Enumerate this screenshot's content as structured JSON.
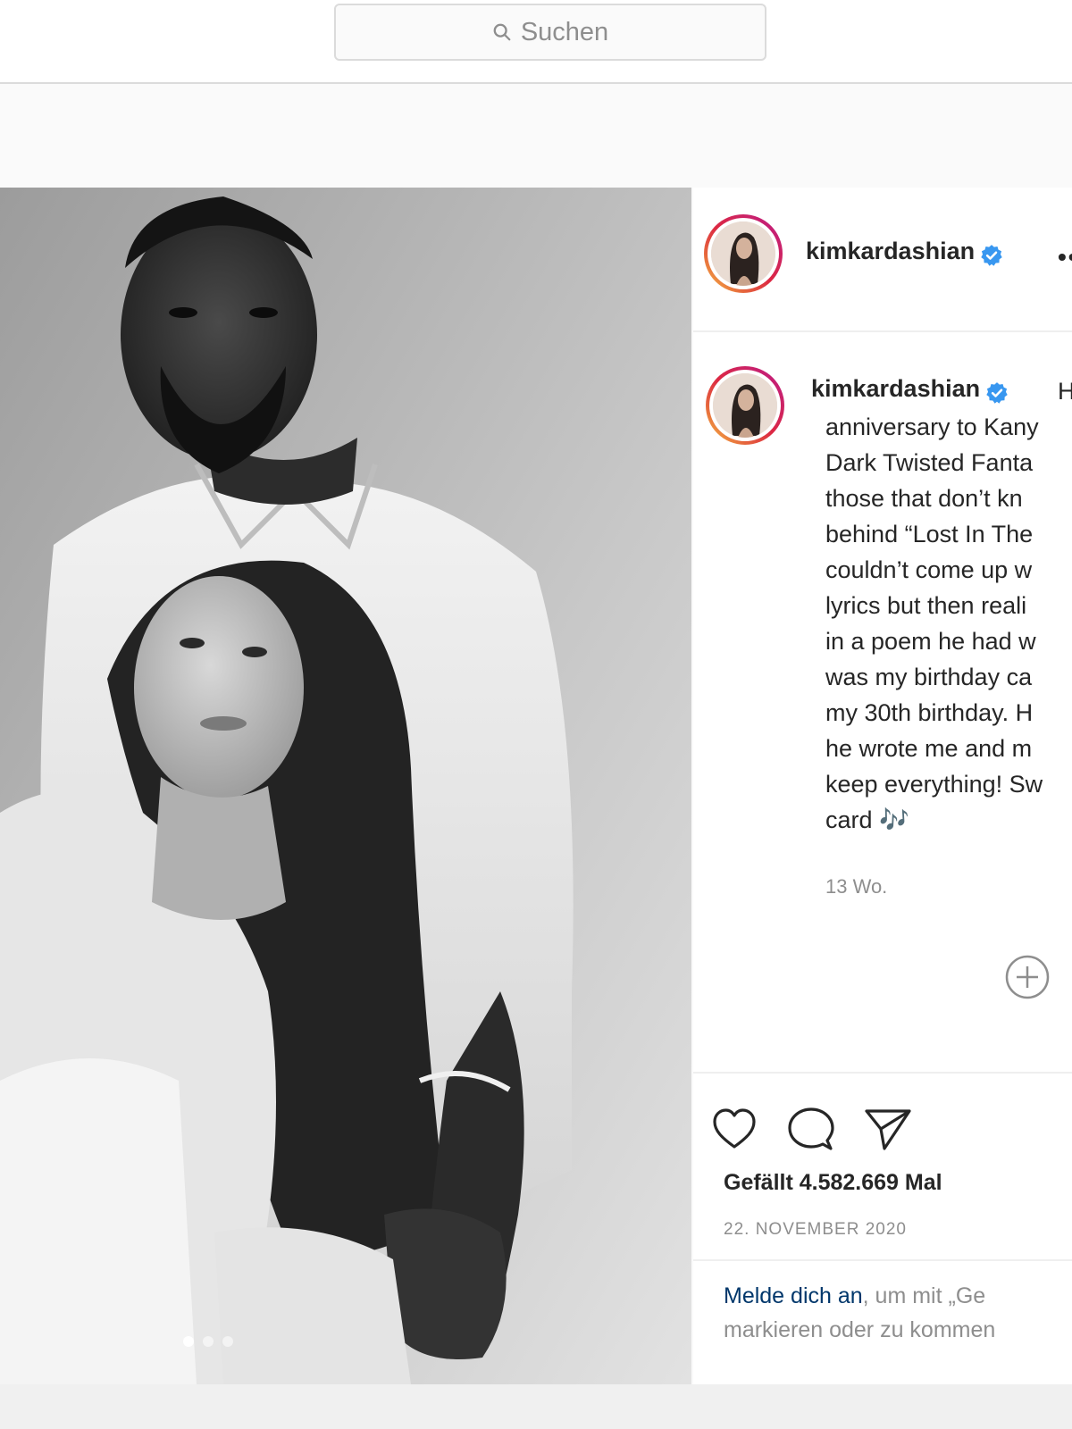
{
  "search": {
    "placeholder": "Suchen",
    "icon": "search-icon"
  },
  "post": {
    "image_alt_icon": "photo",
    "carousel": {
      "total": 3,
      "active": 1
    },
    "author": {
      "username": "kimkardashian",
      "verified": true
    },
    "more_label": "••",
    "caption": {
      "username": "kimkardashian",
      "text_visible": "H\nanniversary to Kany\nDark Twisted Fanta\nthose that don’t kn\nbehind “Lost In The\ncouldn’t come up w\nlyrics but then reali\nin a poem he had w\nwas my birthday ca\nmy 30th birthday. H\nhe wrote me and m\nkeep everything! Sw\ncard 🎶"
    },
    "time_ago": "13 Wo.",
    "likes": "Gefällt 4.582.669 Mal",
    "date": "22. NOVEMBER 2020",
    "login_prompt": {
      "link": "Melde dich an",
      "rest_line1": ", um mit „Ge",
      "line2": "markieren oder zu kommen"
    }
  },
  "colors": {
    "link": "#00376b",
    "verified": "#3897f0",
    "muted": "#8e8e8e"
  }
}
